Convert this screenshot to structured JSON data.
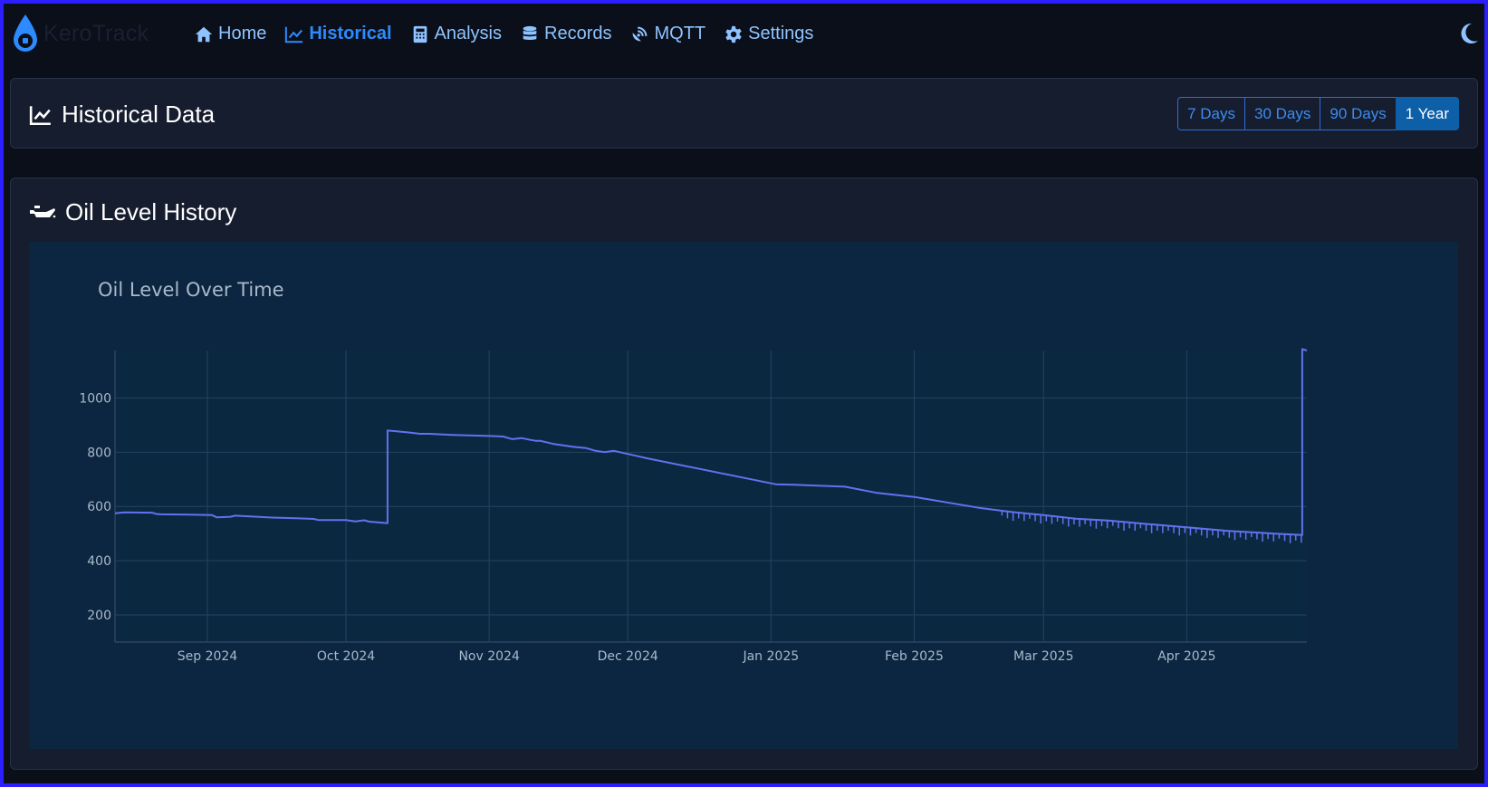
{
  "app": {
    "brand": "KeroTrack"
  },
  "nav": {
    "items": [
      {
        "label": "Home",
        "icon": "home-icon"
      },
      {
        "label": "Historical",
        "icon": "chart-line-icon",
        "active": true
      },
      {
        "label": "Analysis",
        "icon": "calculator-icon"
      },
      {
        "label": "Records",
        "icon": "database-icon"
      },
      {
        "label": "MQTT",
        "icon": "satellite-dish-icon"
      },
      {
        "label": "Settings",
        "icon": "gear-icon"
      }
    ],
    "theme_icon": "moon-icon"
  },
  "historical": {
    "title": "Historical Data",
    "ranges": [
      "7 Days",
      "30 Days",
      "90 Days",
      "1 Year"
    ],
    "active_range": "1 Year"
  },
  "oil_card": {
    "title": "Oil Level History",
    "icon": "oil-can-icon"
  },
  "colors": {
    "accent": "#2d8bff",
    "line": "#6272f0",
    "plot_bg": "#0c2540"
  },
  "chart_data": {
    "type": "line",
    "title": "Oil Level Over Time",
    "xlabel": "",
    "ylabel": "",
    "grid": true,
    "x_ticks": [
      "Sep 2024",
      "Oct 2024",
      "Nov 2024",
      "Dec 2024",
      "Jan 2025",
      "Feb 2025",
      "Mar 2025",
      "Apr 2025"
    ],
    "x_tick_dates": [
      "2024-09-01",
      "2024-10-01",
      "2024-11-01",
      "2024-12-01",
      "2025-01-01",
      "2025-02-01",
      "2025-03-01",
      "2025-04-01"
    ],
    "y_ticks": [
      200,
      400,
      600,
      800,
      1000
    ],
    "xlim": [
      "2024-08-12",
      "2025-04-27"
    ],
    "ylim": [
      100,
      1175
    ],
    "series": [
      {
        "x": [
          "2024-08-12",
          "2024-08-14",
          "2024-08-20",
          "2024-08-21",
          "2024-08-22",
          "2024-08-28",
          "2024-09-02",
          "2024-09-03",
          "2024-09-06",
          "2024-09-07",
          "2024-09-15",
          "2024-09-21",
          "2024-09-24",
          "2024-09-25",
          "2024-10-01",
          "2024-10-03",
          "2024-10-05",
          "2024-10-06",
          "2024-10-09",
          "2024-10-10",
          "2024-10-10",
          "2024-10-12",
          "2024-10-15",
          "2024-10-17",
          "2024-10-19",
          "2024-10-24",
          "2024-11-01",
          "2024-11-04",
          "2024-11-06",
          "2024-11-08",
          "2024-11-10",
          "2024-11-11",
          "2024-11-12",
          "2024-11-15",
          "2024-11-19",
          "2024-11-22",
          "2024-11-24",
          "2024-11-26",
          "2024-11-28",
          "2024-12-04",
          "2024-12-05",
          "2025-01-02",
          "2025-01-06",
          "2025-01-17",
          "2025-01-24",
          "2025-02-01",
          "2025-02-08",
          "2025-02-15",
          "2025-02-22",
          "2025-03-01",
          "2025-03-08",
          "2025-03-15",
          "2025-03-25",
          "2025-04-01",
          "2025-04-10",
          "2025-04-20",
          "2025-04-26",
          "2025-04-26",
          "2025-04-27"
        ],
        "values": [
          575,
          578,
          577,
          572,
          571,
          570,
          568,
          560,
          562,
          566,
          559,
          556,
          554,
          550,
          550,
          545,
          549,
          544,
          540,
          538,
          880,
          877,
          872,
          868,
          868,
          864,
          860,
          858,
          848,
          852,
          845,
          842,
          842,
          830,
          820,
          815,
          805,
          800,
          805,
          782,
          778,
          682,
          680,
          673,
          650,
          635,
          615,
          595,
          580,
          568,
          555,
          548,
          533,
          523,
          510,
          500,
          495,
          1180,
          1175
        ]
      }
    ]
  }
}
